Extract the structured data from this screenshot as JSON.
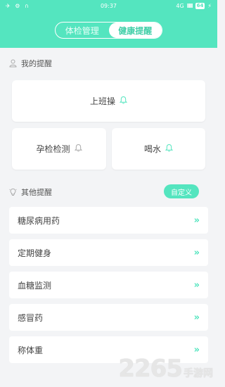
{
  "status_bar": {
    "left_icons": "✈ ⚙ ∩",
    "time": "09:37",
    "network": "4G",
    "signal": "IIII",
    "battery": "64",
    "charging_icon": "⚡"
  },
  "header": {
    "tabs": [
      {
        "label": "体检管理",
        "active": false
      },
      {
        "label": "健康提醒",
        "active": true
      }
    ]
  },
  "my_reminders": {
    "title": "我的提醒",
    "items": [
      {
        "label": "上班操",
        "icon": "bell-icon"
      },
      {
        "label": "孕检检测",
        "icon": "bell-icon"
      },
      {
        "label": "喝水",
        "icon": "bell-icon"
      }
    ]
  },
  "other_reminders": {
    "title": "其他提醒",
    "custom_button": "自定义",
    "items": [
      {
        "label": "糖尿病用药"
      },
      {
        "label": "定期健身"
      },
      {
        "label": "血糖监测"
      },
      {
        "label": "感冒药"
      },
      {
        "label": "称体重"
      }
    ]
  },
  "watermark": {
    "number": "2265",
    "suffix": "手游网"
  },
  "colors": {
    "accent": "#54e5bf",
    "background": "#f3f4f6"
  }
}
